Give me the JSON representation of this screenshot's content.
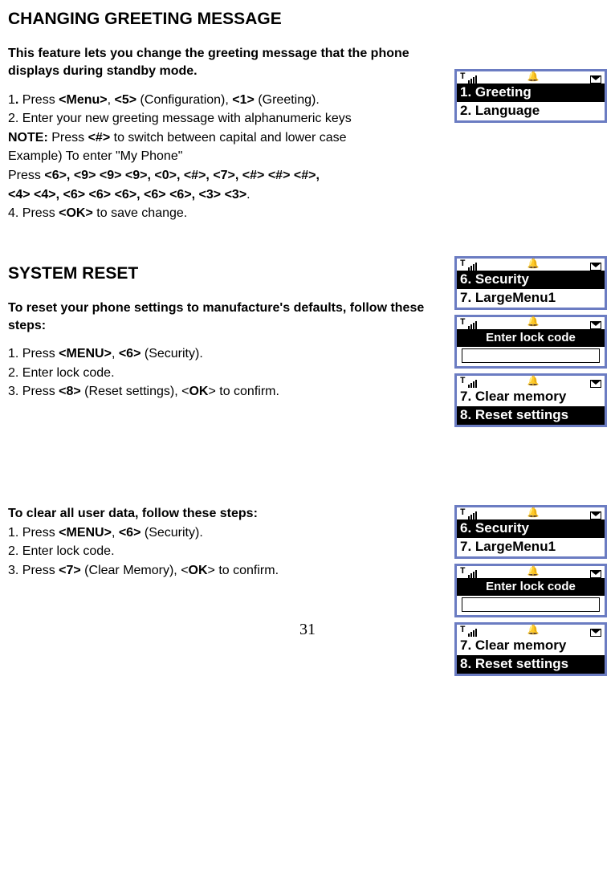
{
  "page_number": "31",
  "section1": {
    "heading": "CHANGING GREETING MESSAGE",
    "intro": "This feature lets you change the greeting message that the phone displays during standby mode.",
    "step1_pre": " 1",
    "step1_mid": " Press ",
    "menu": "<Menu>",
    "comma1": ", ",
    "five": "<5>",
    "config": " (Configuration), ",
    "one": "<1>",
    "greeting_end": " (Greeting).",
    "step2": " 2. Enter your new greeting message with alphanumeric keys",
    "note_pre": "   ",
    "note_label": "NOTE:",
    "note_text": " Press ",
    "hash": "<#>",
    "note_end": " to switch between capital and lower case",
    "example": "Example) To enter \"My Phone\"",
    "press_label": "Press ",
    "keys1": "<6>, <9> <9> <9>, <0>, <#>, <7>, <#> <#> <#>,",
    "keys2": "<4> <4>, <6> <6> <6>, <6> <6>, <3> <3>",
    "dot": ".",
    "step4_pre": "   4. Press ",
    "ok": "<OK>",
    "step4_end": " to save change.",
    "screen": {
      "r1": "1. Greeting",
      "r2": "2. Language"
    }
  },
  "section2": {
    "heading": "SYSTEM RESET",
    "intro": "To reset your phone settings to manufacture's defaults, follow these steps:",
    "s1_pre": "   1. Press ",
    "menu": "<MENU>",
    "comma": ", ",
    "six": "<6>",
    "security": " (Security).",
    "s2": "   2. Enter lock code.",
    "s3_pre": "   3. Press ",
    "eight": "<8>",
    "reset": " (Reset settings), <",
    "ok": "OK",
    "s3_end": "> to confirm.",
    "screenA": {
      "r1": "6. Security",
      "r2": "7. LargeMenu1"
    },
    "screenB": {
      "title": "Enter lock code"
    },
    "screenC": {
      "r1": "7. Clear memory",
      "r2": "8. Reset settings"
    }
  },
  "section3": {
    "intro": "To clear all user data, follow these steps:",
    "s1_pre": "   1. Press ",
    "menu": "<MENU>",
    "comma": ", ",
    "six": "<6>",
    "security": " (Security).",
    "s2": "   2. Enter lock code.",
    "s3_pre": "   3. Press ",
    "seven": "<7>",
    "clear": " (Clear Memory), <",
    "ok": "OK",
    "s3_end": "> to confirm.",
    "screenA": {
      "r1": "6. Security",
      "r2": "7. LargeMenu1"
    },
    "screenB": {
      "title": "Enter lock code"
    },
    "screenC": {
      "r1": "7. Clear memory",
      "r2": "8. Reset settings"
    }
  }
}
